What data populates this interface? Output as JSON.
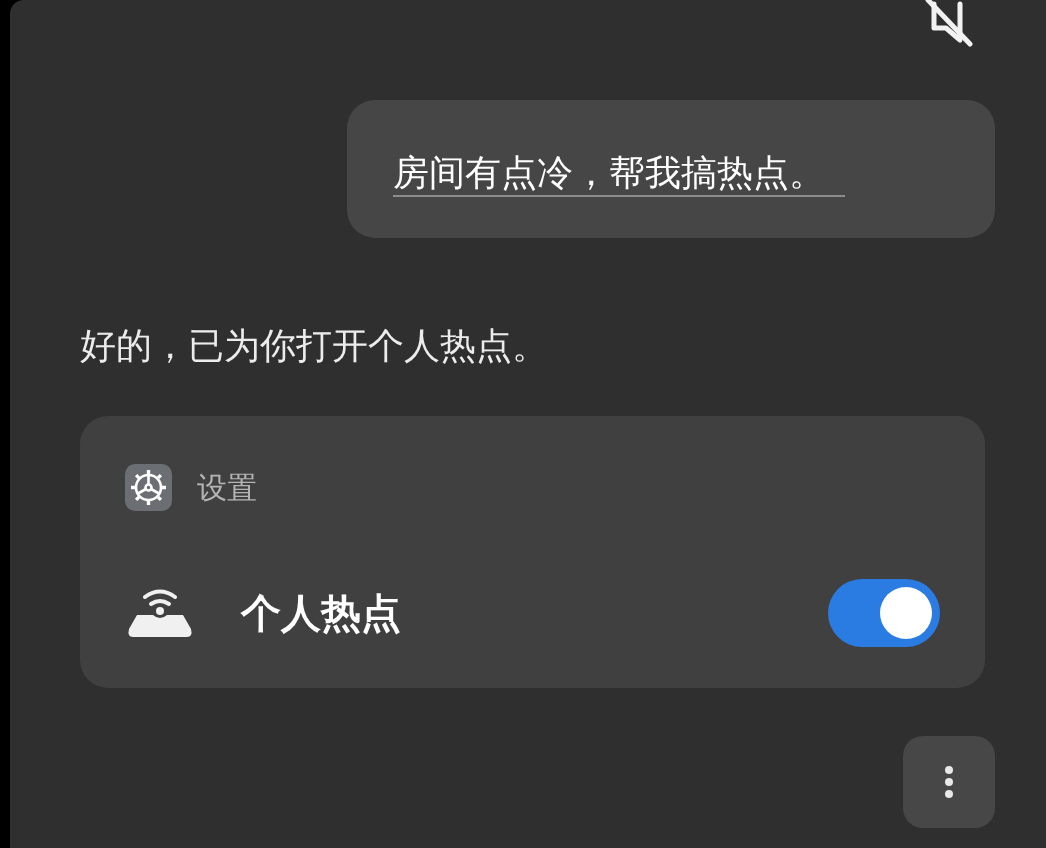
{
  "messages": [
    {
      "kind": "user",
      "text": "房间有点冷，帮我搞热点。"
    },
    {
      "kind": "assistant",
      "text": "好的，已为你打开个人热点。"
    }
  ],
  "card": {
    "app": "设置",
    "setting": {
      "label": "个人热点",
      "on": true
    }
  }
}
